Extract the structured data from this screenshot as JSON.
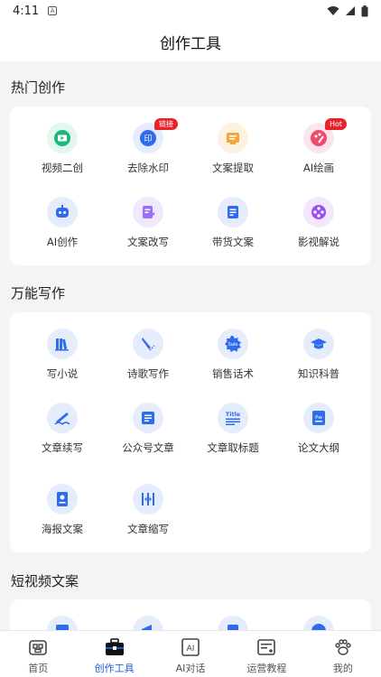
{
  "status": {
    "time": "4:11",
    "notif_letter": "A"
  },
  "header": {
    "title": "创作工具"
  },
  "sections": [
    {
      "title": "热门创作",
      "tools": [
        {
          "label": "视频二创",
          "icon": "video-remix-icon",
          "color": "#1db879",
          "bg": "#e3f7ee"
        },
        {
          "label": "去除水印",
          "icon": "stamp-icon",
          "color": "#2f6bed",
          "bg": "#e5edfd",
          "badge": "链接"
        },
        {
          "label": "文案提取",
          "icon": "copy-extract-icon",
          "color": "#f4a53a",
          "bg": "#fdf1e1"
        },
        {
          "label": "AI绘画",
          "icon": "palette-icon",
          "color": "#ef4a6a",
          "bg": "#fde6eb",
          "badge": "Hot"
        },
        {
          "label": "AI创作",
          "icon": "robot-icon",
          "color": "#2f6bed",
          "bg": "#e5edfd"
        },
        {
          "label": "文案改写",
          "icon": "rewrite-icon",
          "color": "#9b6ef3",
          "bg": "#f0e9fd"
        },
        {
          "label": "带货文案",
          "icon": "sales-doc-icon",
          "color": "#2f6bed",
          "bg": "#e5edfd"
        },
        {
          "label": "影视解说",
          "icon": "film-reel-icon",
          "color": "#9b4ef3",
          "bg": "#f2e7fd"
        }
      ]
    },
    {
      "title": "万能写作",
      "tools": [
        {
          "label": "写小说",
          "icon": "books-icon",
          "color": "#2f6bed",
          "bg": "#e5edfd"
        },
        {
          "label": "诗歌写作",
          "icon": "pen-icon",
          "color": "#2f6bed",
          "bg": "#e5edfd"
        },
        {
          "label": "销售话术",
          "icon": "sale-badge-icon",
          "color": "#2f6bed",
          "bg": "#e5edfd"
        },
        {
          "label": "知识科普",
          "icon": "graduation-cap-icon",
          "color": "#2f6bed",
          "bg": "#e5edfd"
        },
        {
          "label": "文章续写",
          "icon": "continue-write-icon",
          "color": "#2f6bed",
          "bg": "#e5edfd"
        },
        {
          "label": "公众号文章",
          "icon": "article-icon",
          "color": "#2f6bed",
          "bg": "#e5edfd"
        },
        {
          "label": "文章取标题",
          "icon": "title-icon",
          "color": "#2f6bed",
          "bg": "#e5edfd"
        },
        {
          "label": "论文大纲",
          "icon": "paper-outline-icon",
          "color": "#2f6bed",
          "bg": "#e5edfd"
        },
        {
          "label": "海报文案",
          "icon": "poster-icon",
          "color": "#2f6bed",
          "bg": "#e5edfd"
        },
        {
          "label": "文章缩写",
          "icon": "compress-icon",
          "color": "#2f6bed",
          "bg": "#e5edfd"
        }
      ]
    },
    {
      "title": "短视频文案",
      "tools": [
        {
          "label": "",
          "icon": "chart-icon",
          "color": "#2f6bed",
          "bg": "#e5edfd"
        },
        {
          "label": "",
          "icon": "megaphone-icon",
          "color": "#2f6bed",
          "bg": "#e5edfd"
        },
        {
          "label": "",
          "icon": "list-icon",
          "color": "#2f6bed",
          "bg": "#e5edfd"
        },
        {
          "label": "",
          "icon": "music-icon",
          "color": "#2f6bed",
          "bg": "#e5edfd"
        }
      ]
    }
  ],
  "nav": [
    {
      "label": "首页",
      "icon": "home-icon",
      "active": false
    },
    {
      "label": "创作工具",
      "icon": "toolbox-icon",
      "active": true
    },
    {
      "label": "AI对话",
      "icon": "ai-chat-icon",
      "active": false
    },
    {
      "label": "运营教程",
      "icon": "tutorial-icon",
      "active": false
    },
    {
      "label": "我的",
      "icon": "paw-icon",
      "active": false
    }
  ],
  "colors": {
    "accent": "#1f5fe6",
    "badge": "#e8232b"
  }
}
